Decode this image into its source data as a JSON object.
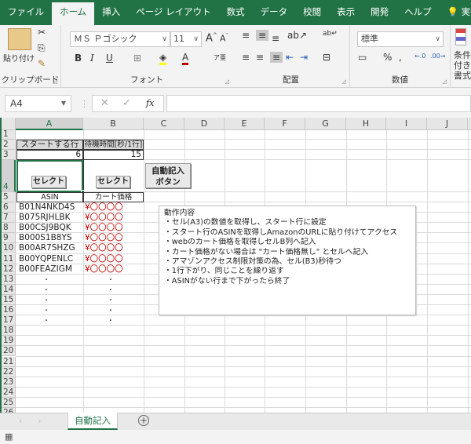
{
  "tabs": [
    {
      "label": "ファイル"
    },
    {
      "label": "ホーム"
    },
    {
      "label": "挿入"
    },
    {
      "label": "ページ レイアウト"
    },
    {
      "label": "数式"
    },
    {
      "label": "データ"
    },
    {
      "label": "校閲"
    },
    {
      "label": "表示"
    },
    {
      "label": "開発"
    },
    {
      "label": "ヘルプ"
    },
    {
      "label": "実行したい作業を"
    }
  ],
  "ribbon": {
    "clipboard": {
      "paste_label": "貼り付け",
      "group_label": "クリップボード"
    },
    "font": {
      "font_name": "ＭＳ Ｐゴシック",
      "font_size": "11",
      "group_label": "フォント",
      "bold": "B",
      "italic": "I",
      "underline": "U"
    },
    "alignment": {
      "group_label": "配置"
    },
    "number": {
      "format": "標準",
      "group_label": "数値",
      "percent": "%",
      "comma": ","
    },
    "styles": {
      "conditional_label": "条件付き書式"
    }
  },
  "formula_bar": {
    "name_box": "A4",
    "fx": "fx",
    "formula": ""
  },
  "columns": [
    "A",
    "B",
    "C",
    "D",
    "E",
    "F",
    "G",
    "H",
    "I",
    "J"
  ],
  "rows": [
    "1",
    "2",
    "3",
    "4",
    "5",
    "6",
    "7",
    "8",
    "9",
    "10",
    "11",
    "12",
    "13",
    "14",
    "15",
    "16",
    "17",
    "18",
    "19",
    "20",
    "21",
    "22",
    "23",
    "24",
    "25",
    "26"
  ],
  "cells": {
    "a2": "スタートする行",
    "b2": "待機時間[秒/1行]",
    "a3": "6",
    "b3": "15",
    "a5": "ASIN",
    "b5": "カート価格",
    "asins": [
      "B01N4NKD4S",
      "B075RJHLBK",
      "B00CSJ9BQK",
      "B000S1B8YS",
      "B00AR7SHZG",
      "B00YQPENLC",
      "B00FEAZIGM"
    ],
    "price": "¥〇〇〇〇",
    "dot": "・"
  },
  "buttons": {
    "select_a": "セレクト",
    "select_b": "セレクト",
    "auto_line1": "自動記入",
    "auto_line2": "ボタン"
  },
  "notes": {
    "title": "動作内容",
    "lines": [
      "・セル(A3)の数値を取得し、スタート行に設定",
      "・スタート行のASINを取得しAmazonのURLに貼り付けてアクセス",
      "・webのカート価格を取得しセルB列へ記入",
      "・カート価格がない場合は \"カート価格無し\" とセルへ記入",
      "・アマゾンアクセス制限対策の為、セル(B3)秒待つ",
      "・1行下がり、同じことを繰り返す",
      "・ASINがない行まで下がったら終了"
    ]
  },
  "sheet_tabs": {
    "active": "自動記入",
    "add": "+"
  },
  "colors": {
    "accent": "#217346",
    "price": "#c00000"
  }
}
